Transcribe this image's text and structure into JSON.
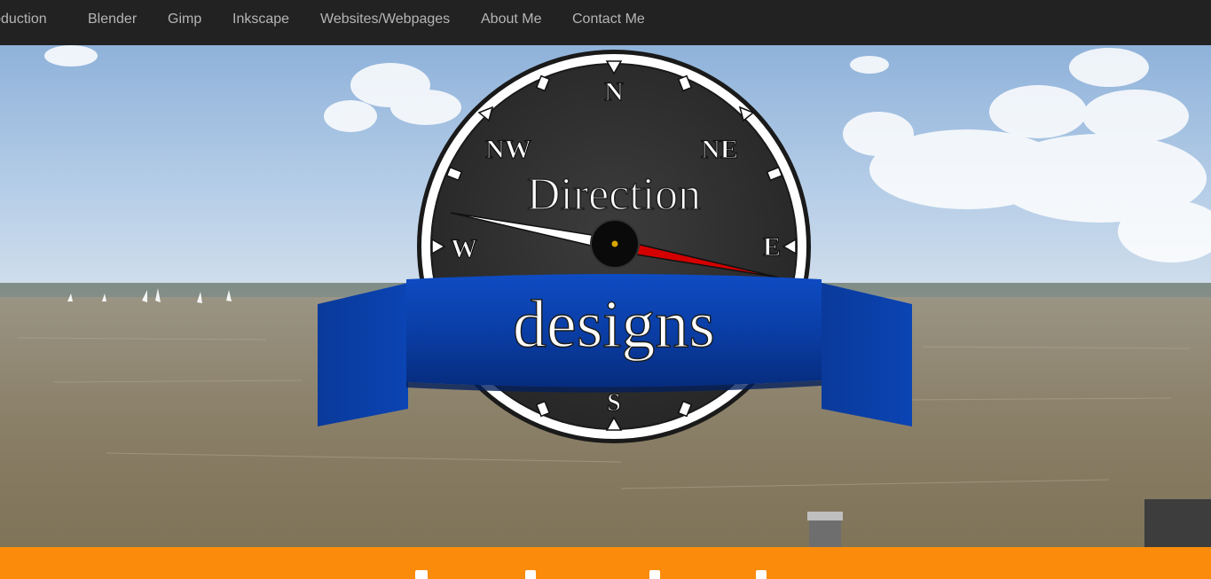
{
  "nav": {
    "items": [
      {
        "label": "Introduction"
      },
      {
        "label": "Blender"
      },
      {
        "label": "Gimp"
      },
      {
        "label": "Inkscape"
      },
      {
        "label": "Websites/Webpages"
      },
      {
        "label": "About Me"
      },
      {
        "label": "Contact Me"
      }
    ]
  },
  "logo": {
    "word_top": "Direction",
    "word_bottom": "designs",
    "compass": {
      "north": "N",
      "south": "S",
      "east": "E",
      "west": "W",
      "northwest": "NW",
      "northeast": "NE"
    }
  },
  "colors": {
    "navbar_bg": "#222222",
    "nav_text": "#b5b5b5",
    "ribbon_blue": "#0a3ea6",
    "needle_red": "#d40000",
    "accent_orange": "#fb8c0b",
    "sky": "#a9c6e6",
    "water": "#8a7e66"
  }
}
